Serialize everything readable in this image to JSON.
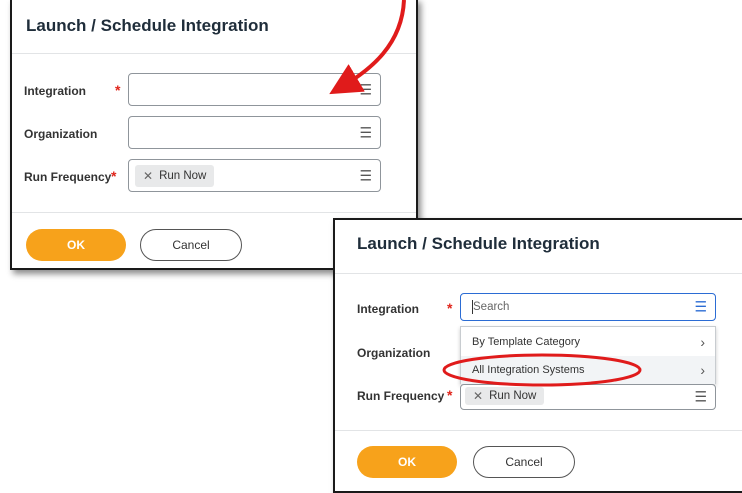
{
  "dialog_main": {
    "title": "Launch / Schedule Integration",
    "fields": {
      "integration_label": "Integration",
      "organization_label": "Organization",
      "run_frequency_label": "Run Frequency",
      "run_frequency_value": "Run Now",
      "required_marker": "*"
    },
    "buttons": {
      "ok": "OK",
      "cancel": "Cancel"
    }
  },
  "dialog_zoom": {
    "title": "Launch / Schedule Integration",
    "fields": {
      "integration_label": "Integration",
      "organization_label": "Organization",
      "run_frequency_label": "Run Frequency",
      "run_frequency_value": "Run Now",
      "required_marker": "*",
      "search_placeholder": "Search"
    },
    "menu": {
      "items": [
        {
          "label": "By Template Category"
        },
        {
          "label": "All Integration Systems"
        }
      ]
    },
    "buttons": {
      "ok": "OK",
      "cancel": "Cancel"
    }
  },
  "icons": {
    "prompt": "list-icon",
    "remove": "x-icon",
    "submenu": "chevron-right-icon"
  },
  "colors": {
    "accent_ok": "#f7a21b",
    "required": "#e0251b",
    "focus": "#2b6cd4",
    "annotation": "#e01b1b"
  }
}
